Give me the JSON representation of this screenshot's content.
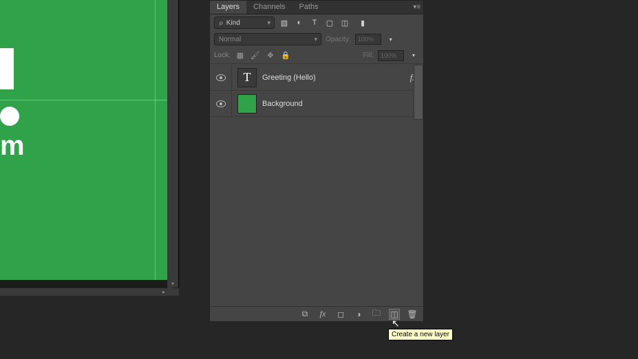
{
  "tabs": {
    "layers": "Layers",
    "channels": "Channels",
    "paths": "Paths"
  },
  "filter": {
    "kind": "Kind"
  },
  "blend": {
    "mode": "Normal",
    "opacity_label": "Opacity:",
    "opacity_value": "100%"
  },
  "lock": {
    "label": "Lock:",
    "fill_label": "Fill:",
    "fill_value": "100%"
  },
  "layers": [
    {
      "name": "Greeting (Hello)",
      "type": "text",
      "fx": "fx"
    },
    {
      "name": "Background",
      "type": "image"
    }
  ],
  "tooltip": "Create a new layer",
  "canvas_text": "m"
}
